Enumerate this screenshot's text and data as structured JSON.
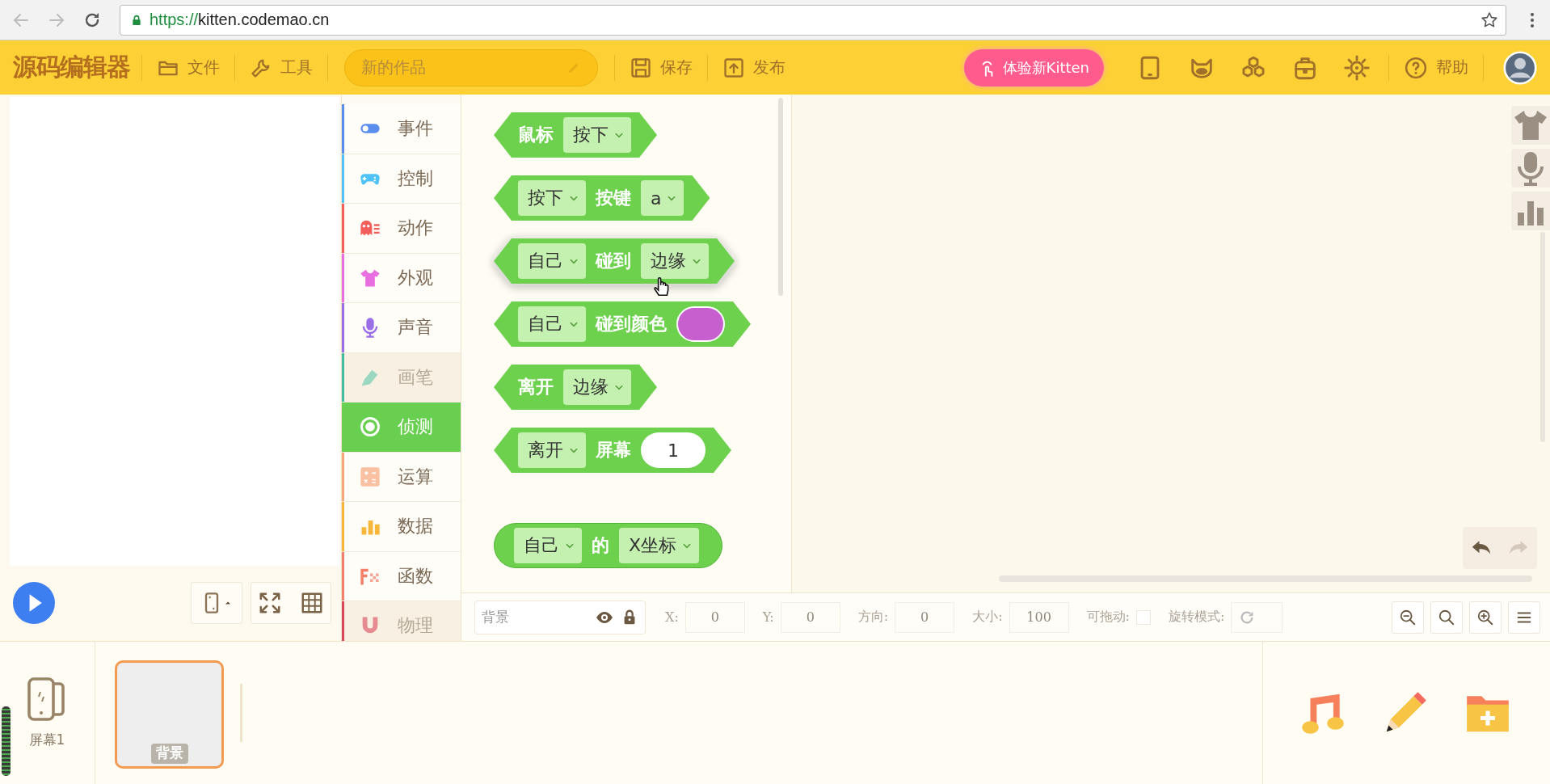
{
  "browser": {
    "url_scheme": "https://",
    "url_host": "kitten.codemao.cn"
  },
  "header": {
    "logo": "源码编辑器",
    "menus": [
      "文件",
      "工具"
    ],
    "project_name": "新的作品",
    "actions": [
      "保存",
      "发布"
    ],
    "promo": "体验新Kitten",
    "help": "帮助"
  },
  "categories": [
    {
      "label": "事件",
      "color": "#5b8def",
      "selected": false,
      "disabled": false
    },
    {
      "label": "控制",
      "color": "#4fc3f7",
      "selected": false,
      "disabled": false
    },
    {
      "label": "动作",
      "color": "#f25f5c",
      "selected": false,
      "disabled": false
    },
    {
      "label": "外观",
      "color": "#e96fe0",
      "selected": false,
      "disabled": false
    },
    {
      "label": "声音",
      "color": "#9b6ee8",
      "selected": false,
      "disabled": false
    },
    {
      "label": "画笔",
      "color": "#3fbf9f",
      "selected": false,
      "disabled": true
    },
    {
      "label": "侦测",
      "color": "#68cf50",
      "selected": true,
      "disabled": false
    },
    {
      "label": "运算",
      "color": "#f6a77c",
      "selected": false,
      "disabled": false
    },
    {
      "label": "数据",
      "color": "#f7b73b",
      "selected": false,
      "disabled": false
    },
    {
      "label": "函数",
      "color": "#f27f6b",
      "selected": false,
      "disabled": false
    },
    {
      "label": "物理",
      "color": "#d9475a",
      "selected": false,
      "disabled": true
    }
  ],
  "blocks": [
    {
      "kind": "hexagon",
      "hovered": false,
      "parts": [
        {
          "kind": "text",
          "text": "鼠标"
        },
        {
          "kind": "dropdown",
          "value": "按下"
        }
      ]
    },
    {
      "kind": "hexagon",
      "hovered": false,
      "parts": [
        {
          "kind": "dropdown",
          "value": "按下"
        },
        {
          "kind": "text",
          "text": "按键"
        },
        {
          "kind": "dropdown",
          "value": "a"
        }
      ]
    },
    {
      "kind": "hexagon",
      "hovered": true,
      "parts": [
        {
          "kind": "dropdown",
          "value": "自己"
        },
        {
          "kind": "text",
          "text": "碰到"
        },
        {
          "kind": "dropdown",
          "value": "边缘"
        }
      ]
    },
    {
      "kind": "hexagon",
      "hovered": false,
      "parts": [
        {
          "kind": "dropdown",
          "value": "自己"
        },
        {
          "kind": "text",
          "text": "碰到颜色"
        },
        {
          "kind": "color",
          "color": "#c75fcf"
        }
      ]
    },
    {
      "kind": "hexagon",
      "hovered": false,
      "parts": [
        {
          "kind": "text",
          "text": "离开"
        },
        {
          "kind": "dropdown",
          "value": "边缘"
        }
      ]
    },
    {
      "kind": "hexagon",
      "hovered": false,
      "parts": [
        {
          "kind": "dropdown",
          "value": "离开"
        },
        {
          "kind": "text",
          "text": "屏幕"
        },
        {
          "kind": "number",
          "value": "1"
        }
      ]
    },
    {
      "kind": "round",
      "hovered": false,
      "parts": [
        {
          "kind": "dropdown",
          "value": "自己"
        },
        {
          "kind": "text",
          "text": "的"
        },
        {
          "kind": "dropdown",
          "value": "X坐标"
        }
      ]
    }
  ],
  "properties": {
    "sprite": "背景",
    "fields": [
      {
        "kind": "input",
        "label": "X:",
        "value": "0"
      },
      {
        "kind": "input",
        "label": "Y:",
        "value": "0"
      },
      {
        "kind": "input",
        "label": "方向:",
        "value": "0"
      },
      {
        "kind": "input",
        "label": "大小:",
        "value": "100"
      },
      {
        "kind": "checkbox",
        "label": "可拖动:",
        "checked": false
      },
      {
        "kind": "rotate",
        "label": "旋转模式:"
      }
    ]
  },
  "screens": [
    {
      "label": "屏幕1"
    }
  ],
  "backgrounds": [
    {
      "label": "背景",
      "selected": true
    }
  ]
}
